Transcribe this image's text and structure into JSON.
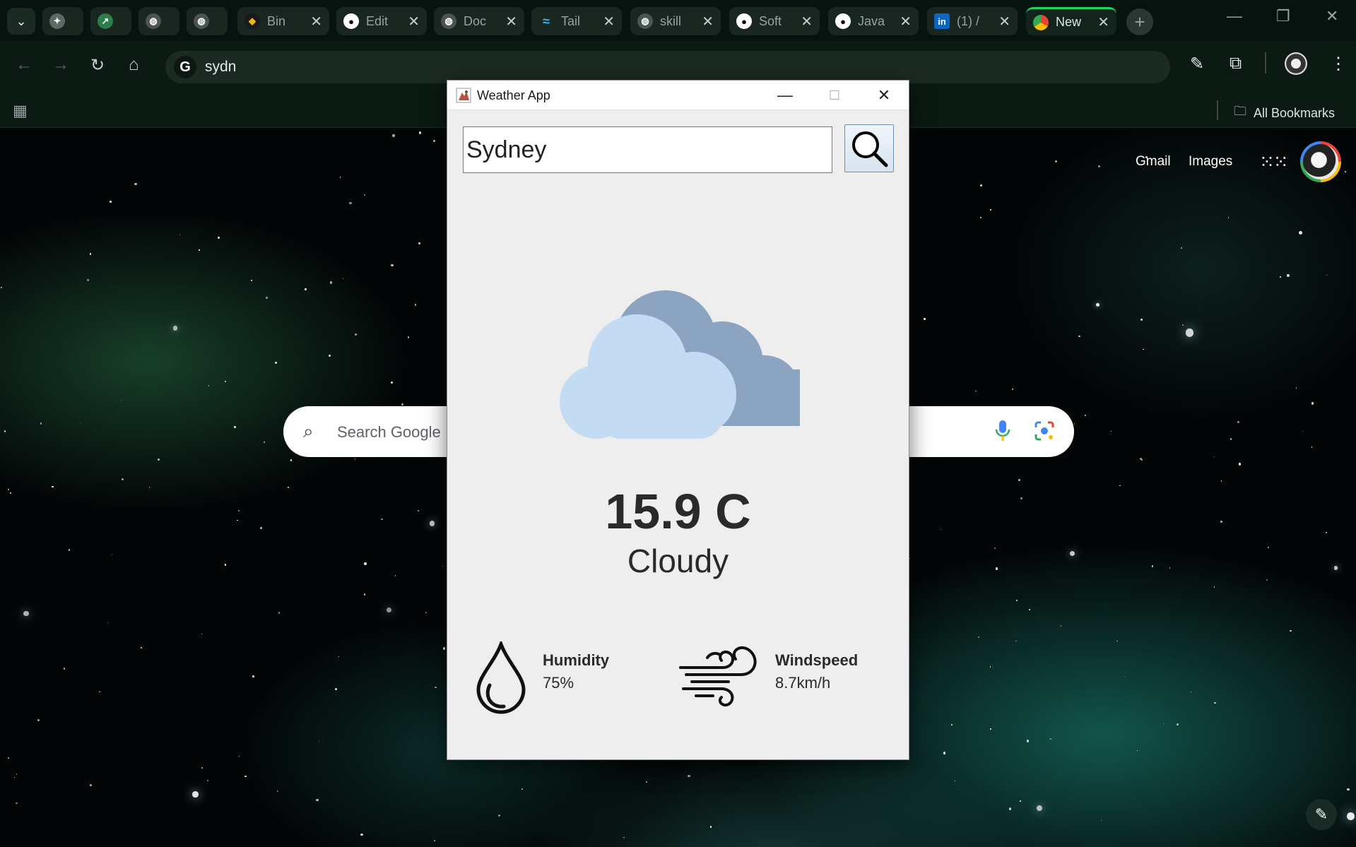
{
  "browser": {
    "tabs": [
      {
        "label": "",
        "icon": "puzzle-icon"
      },
      {
        "label": "",
        "icon": "chart-icon"
      },
      {
        "label": "",
        "icon": "globe-icon"
      },
      {
        "label": "",
        "icon": "globe-icon"
      },
      {
        "label": "Bin",
        "icon": "binance-icon"
      },
      {
        "label": "Edit",
        "icon": "github-icon"
      },
      {
        "label": "Doc",
        "icon": "globe-icon"
      },
      {
        "label": "Tail",
        "icon": "tailwind-icon"
      },
      {
        "label": "skill",
        "icon": "globe-icon"
      },
      {
        "label": "Soft",
        "icon": "github-icon"
      },
      {
        "label": "Java",
        "icon": "github-icon"
      },
      {
        "label": "(1) /",
        "icon": "linkedin-icon"
      },
      {
        "label": "New",
        "icon": "chrome-icon"
      }
    ],
    "omnibox_text": "sydn",
    "all_bookmarks_label": "All Bookmarks",
    "accent_color": "#0b1a12"
  },
  "newtab": {
    "gmail_label": "Gmail",
    "images_label": "Images",
    "search_placeholder": "Search Google"
  },
  "weather_app": {
    "window_title": "Weather App",
    "city_input_value": "Sydney",
    "temperature": "15.9 C",
    "condition": "Cloudy",
    "weather_icon": "cloudy-icon",
    "humidity_label": "Humidity",
    "humidity_value": "75%",
    "windspeed_label": "Windspeed",
    "windspeed_value": "8.7km/h"
  }
}
